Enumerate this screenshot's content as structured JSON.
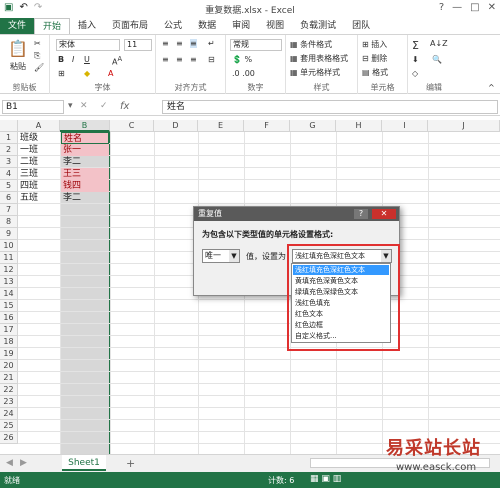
{
  "window": {
    "title": "重复数据.xlsx - Excel",
    "qat_icons": [
      "save-icon",
      "undo-icon",
      "redo-icon"
    ],
    "win_controls": [
      "?",
      "—",
      "□",
      "✕"
    ]
  },
  "tabs": {
    "file": "文件",
    "items": [
      "开始",
      "插入",
      "页面布局",
      "公式",
      "数据",
      "审阅",
      "视图",
      "负载测试",
      "团队"
    ],
    "active": "开始"
  },
  "ribbon": {
    "clipboard": {
      "paste": "粘贴",
      "label": "剪贴板"
    },
    "font": {
      "name": "宋体",
      "size": "11",
      "label": "字体"
    },
    "alignment": {
      "label": "对齐方式"
    },
    "number": {
      "format": "常规",
      "label": "数字"
    },
    "styles": {
      "cond": "条件格式",
      "table": "套用表格格式",
      "cell": "单元格样式",
      "label": "样式"
    },
    "cells": {
      "insert": "插入",
      "delete": "删除",
      "format": "格式",
      "label": "单元格"
    },
    "editing": {
      "label": "编辑"
    }
  },
  "formula_bar": {
    "name_box": "B1",
    "fx": "fx",
    "content": "姓名"
  },
  "columns": [
    "A",
    "B",
    "C",
    "D",
    "E",
    "F",
    "G",
    "H",
    "I",
    "J"
  ],
  "rows": [
    "1",
    "2",
    "3",
    "4",
    "5",
    "6",
    "7",
    "8",
    "9",
    "10",
    "11",
    "12",
    "13",
    "14",
    "15",
    "16",
    "17",
    "18",
    "19",
    "20",
    "21",
    "22",
    "23",
    "24",
    "25",
    "26"
  ],
  "cells": {
    "A": [
      "班级",
      "一班",
      "二班",
      "三班",
      "四班",
      "五班"
    ],
    "B": [
      "姓名",
      "张一",
      "李二",
      "王三",
      "钱四",
      "李二"
    ]
  },
  "dialog": {
    "title": "重复值",
    "prompt": "为包含以下类型值的单元格设置格式:",
    "type_value": "唯一",
    "set_as": "值，设置为",
    "format_value": "浅红填充色深红色文本",
    "options": [
      "浅红填充色深红色文本",
      "黄填充色深黄色文本",
      "绿填充色深绿色文本",
      "浅红色填充",
      "红色文本",
      "红色边框",
      "自定义格式..."
    ],
    "help": "?",
    "close": "✕"
  },
  "sheet_tabs": {
    "items": [
      "Sheet1"
    ],
    "add": "+"
  },
  "status": {
    "ready": "就绪",
    "count": "计数: 6"
  },
  "watermark": {
    "brand": "易采站长站",
    "url": "www.easck.com"
  },
  "colors": {
    "excel_green": "#217346",
    "dup_fill": "#f3c2c8",
    "dup_text": "#9c0006",
    "highlight": "#e03030"
  }
}
